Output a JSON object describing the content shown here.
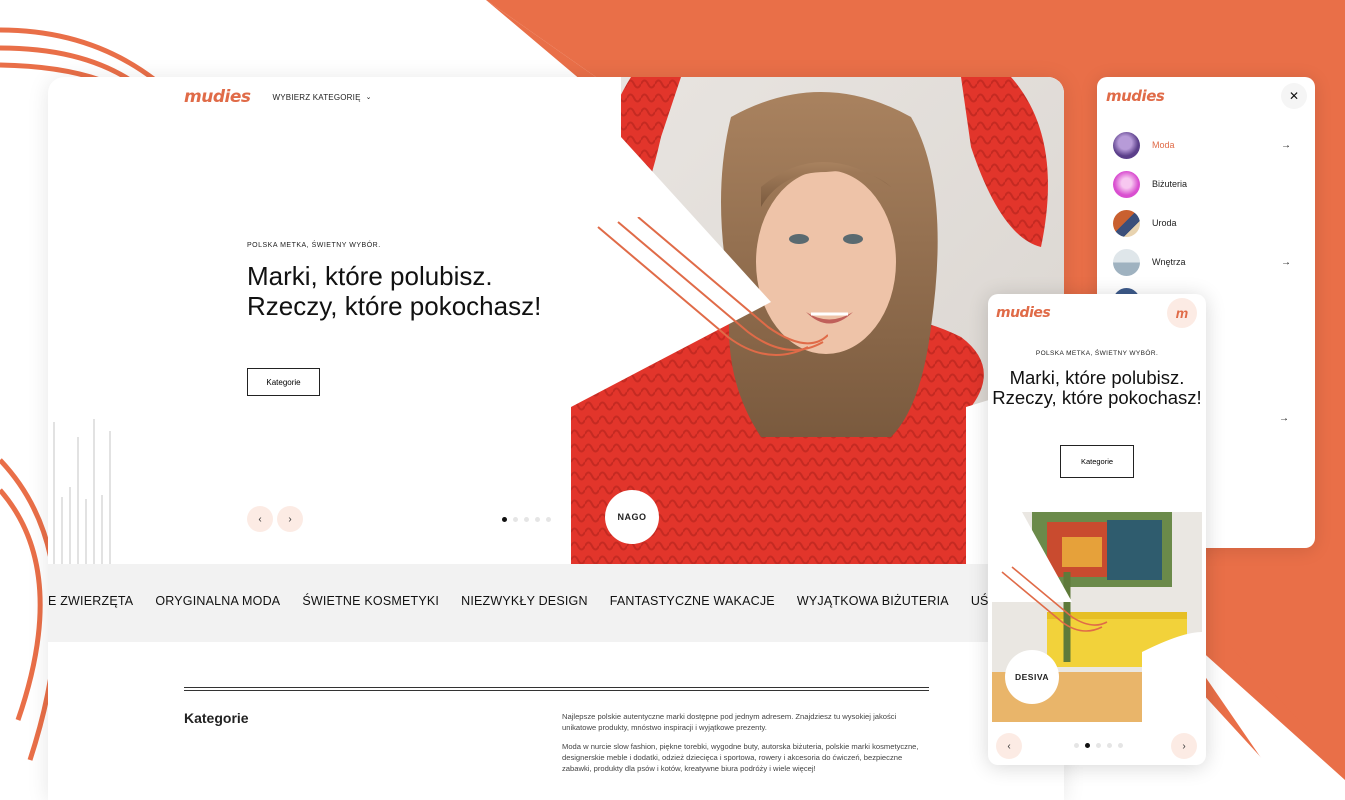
{
  "colors": {
    "brand": "#e06b48",
    "background_accent": "#e96f48",
    "soft_accent": "#fcebe4"
  },
  "desktop": {
    "logo": "mudies",
    "category_select": "WYBIERZ KATEGORIĘ",
    "hero": {
      "eyebrow": "POLSKA METKA, ŚWIETNY WYBÓR.",
      "headline": "Marki, które polubisz. Rzeczy, które pokochasz!",
      "cta_label": "Kategorie",
      "prev_icon": "chevron-left-icon",
      "next_icon": "chevron-right-icon",
      "slide_count": 5,
      "active_slide": 1,
      "brand_badge": "NAGO"
    },
    "marquee": [
      "WE ZWIERZĘTA",
      "ORYGINALNA MODA",
      "ŚWIETNE KOSMETYKI",
      "NIEZWYKŁY DESIGN",
      "FANTASTYCZNE WAKACJE",
      "WYJĄTKOWA BIŻUTERIA",
      "UŚMIECHNIĘTE"
    ],
    "section": {
      "title": "Kategorie",
      "paragraph_1": "Najlepsze polskie autentyczne marki dostępne pod jednym adresem. Znajdziesz tu wysokiej jakości unikatowe produkty, mnóstwo inspiracji i wyjątkowe prezenty.",
      "paragraph_2": "Moda w nurcie slow fashion, piękne torebki, wygodne buty, autorska biżuteria, polskie marki kosmetyczne, designerskie meble i dodatki, odzież dziecięca i sportowa, rowery i akcesoria do ćwiczeń, bezpieczne zabawki, produkty dla psów i kotów, kreatywne biura podróży i wiele więcej!"
    }
  },
  "menu": {
    "logo": "mudies",
    "close_icon": "close-icon",
    "items": [
      {
        "label": "Moda",
        "active": true,
        "has_arrow": true,
        "thumb_color": "#5b3f8a"
      },
      {
        "label": "Biżuteria",
        "active": false,
        "has_arrow": false,
        "thumb_color": "#d94fd0"
      },
      {
        "label": "Uroda",
        "active": false,
        "has_arrow": false,
        "thumb_color": "#c9602f"
      },
      {
        "label": "Wnętrza",
        "active": false,
        "has_arrow": true,
        "thumb_color": "#9fb2c0"
      }
    ],
    "arrow_icon": "arrow-right-icon"
  },
  "mobile": {
    "logo": "mudies",
    "avatar_letter": "m",
    "eyebrow": "POLSKA METKA, ŚWIETNY WYBÓR.",
    "headline": "Marki, które polubisz. Rzeczy, które pokochasz!",
    "cta_label": "Kategorie",
    "brand_badge": "DESIVA",
    "slide_count": 5,
    "active_slide": 2
  }
}
